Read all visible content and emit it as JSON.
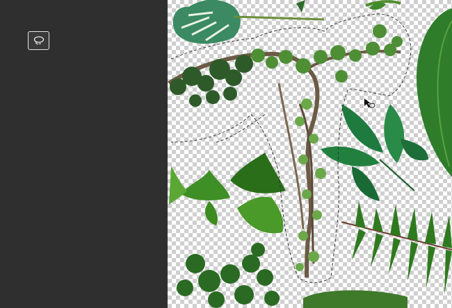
{
  "toolbar": {
    "active_tool": "lasso-tool",
    "tool_icon": "lasso-icon"
  },
  "canvas": {
    "background": "transparency-checkerboard",
    "selection": "marching-ants",
    "cursor": "lasso-cursor"
  },
  "colors": {
    "panel": "#2f2f2f",
    "leaf_dark": "#1f6b2f",
    "leaf_light": "#4f9a2c",
    "vine": "#6b5a45"
  }
}
